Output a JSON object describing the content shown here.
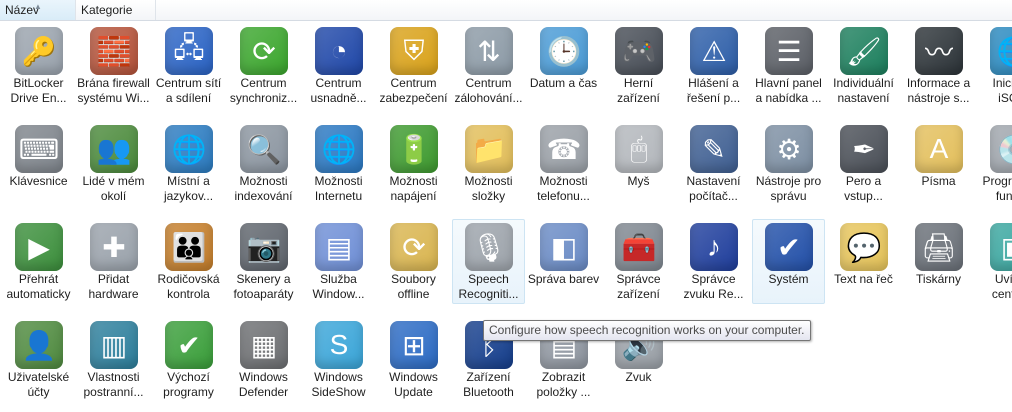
{
  "columns": [
    {
      "label": "Název",
      "sorted": true
    },
    {
      "label": "Kategorie",
      "sorted": false
    }
  ],
  "rows": [
    [
      {
        "label": "BitLocker Drive En...",
        "icon": "bitlocker-drive-icon",
        "color": "#9aa3ad",
        "glyph": "🔑"
      },
      {
        "label": "Brána firewall systému Wi...",
        "icon": "firewall-brick-icon",
        "color": "#b5533a",
        "glyph": "🧱"
      },
      {
        "label": "Centrum sítí a sdílení",
        "icon": "network-center-icon",
        "color": "#2a63c4",
        "glyph": "🖧"
      },
      {
        "label": "Centrum synchroniz...",
        "icon": "sync-center-icon",
        "color": "#3ba62d",
        "glyph": "⟳"
      },
      {
        "label": "Centrum usnadně...",
        "icon": "ease-of-access-icon",
        "color": "#1f47a8",
        "glyph": "◔"
      },
      {
        "label": "Centrum zabezpečení",
        "icon": "security-shield-icon",
        "color": "#d9a21a",
        "glyph": "⛨"
      },
      {
        "label": "Centrum zálohování...",
        "icon": "backup-center-icon",
        "color": "#8c9aa6",
        "glyph": "⇅"
      },
      {
        "label": "Datum a čas",
        "icon": "date-time-icon",
        "color": "#4a9bd6",
        "glyph": "🕒"
      },
      {
        "label": "Herní zařízení",
        "icon": "gamepad-icon",
        "color": "#474d56",
        "glyph": "🎮"
      },
      {
        "label": "Hlášení a řešení p...",
        "icon": "problem-reports-icon",
        "color": "#2d5ea8",
        "glyph": "⚠"
      },
      {
        "label": "Hlavní panel a nabídka ...",
        "icon": "taskbar-start-menu-icon",
        "color": "#5b5f66",
        "glyph": "☰"
      },
      {
        "label": "Individuální nastavení",
        "icon": "personalization-icon",
        "color": "#1c7f5d",
        "glyph": "🖌"
      },
      {
        "label": "Informace a nástroje s...",
        "icon": "performance-info-icon",
        "color": "#2c3338",
        "glyph": "〰"
      },
      {
        "label": "Iniciátor iSCSI",
        "icon": "iscsi-globe-icon",
        "color": "#2a8ac0",
        "glyph": "🌐"
      }
    ],
    [
      {
        "label": "Klávesnice",
        "icon": "keyboard-icon",
        "color": "#7f858c",
        "glyph": "⌨"
      },
      {
        "label": "Lidé v mém okolí",
        "icon": "people-near-me-icon",
        "color": "#4b8a3b",
        "glyph": "👥"
      },
      {
        "label": "Místní a jazykov...",
        "icon": "regional-clock-globe-icon",
        "color": "#2b7bc0",
        "glyph": "🌐"
      },
      {
        "label": "Možnosti indexování",
        "icon": "indexing-icon",
        "color": "#8b95a0",
        "glyph": "🔍"
      },
      {
        "label": "Možnosti Internetu",
        "icon": "internet-options-icon",
        "color": "#2a78c2",
        "glyph": "🌐"
      },
      {
        "label": "Možnosti napájení",
        "icon": "power-options-icon",
        "color": "#3e9a2f",
        "glyph": "🔋"
      },
      {
        "label": "Možnosti složky",
        "icon": "folder-options-icon",
        "color": "#e2be5a",
        "glyph": "📁"
      },
      {
        "label": "Možnosti telefonu...",
        "icon": "phone-modem-icon",
        "color": "#9aa0a7",
        "glyph": "☎"
      },
      {
        "label": "Myš",
        "icon": "mouse-icon",
        "color": "#b3b7bc",
        "glyph": "🖱"
      },
      {
        "label": "Nastavení počítač...",
        "icon": "tablet-pc-icon",
        "color": "#3f5f92",
        "glyph": "✎"
      },
      {
        "label": "Nástroje pro správu",
        "icon": "admin-tools-icon",
        "color": "#7d8fa3",
        "glyph": "⚙"
      },
      {
        "label": "Pero a vstup...",
        "icon": "pen-input-icon",
        "color": "#4a4f57",
        "glyph": "✒"
      },
      {
        "label": "Písma",
        "icon": "fonts-folder-icon",
        "color": "#e3bf5c",
        "glyph": "A"
      },
      {
        "label": "Programy a funkce",
        "icon": "programs-disc-icon",
        "color": "#a0a6ad",
        "glyph": "💿"
      }
    ],
    [
      {
        "label": "Přehrát automaticky",
        "icon": "autoplay-icon",
        "color": "#3c8f3c",
        "glyph": "▶"
      },
      {
        "label": "Přidat hardware",
        "icon": "add-hardware-icon",
        "color": "#9aa2ab",
        "glyph": "✚"
      },
      {
        "label": "Rodičovská kontrola",
        "icon": "parental-controls-icon",
        "color": "#c47e2b",
        "glyph": "👪"
      },
      {
        "label": "Skenery a fotoaparáty",
        "icon": "scanner-camera-icon",
        "color": "#5f656d",
        "glyph": "📷"
      },
      {
        "label": "Služba Window...",
        "icon": "cardspace-icon",
        "color": "#6f8fd6",
        "glyph": "▤"
      },
      {
        "label": "Soubory offline",
        "icon": "offline-files-icon",
        "color": "#d9b550",
        "glyph": "⟳"
      },
      {
        "label": "Speech Recogniti...",
        "icon": "microphone-icon",
        "color": "#9ea4ab",
        "glyph": "🎙",
        "hover": true
      },
      {
        "label": "Správa barev",
        "icon": "color-management-icon",
        "color": "#6a8bc5",
        "glyph": "◧"
      },
      {
        "label": "Správce zařízení",
        "icon": "device-manager-icon",
        "color": "#7f8790",
        "glyph": "🧰"
      },
      {
        "label": "Správce zvuku Re...",
        "icon": "realtek-audio-icon",
        "color": "#1f3e9c",
        "glyph": "♪"
      },
      {
        "label": "Systém",
        "icon": "system-computer-icon",
        "color": "#2350a8",
        "glyph": "✔",
        "hover": true
      },
      {
        "label": "Text na řeč",
        "icon": "text-to-speech-icon",
        "color": "#e6c45a",
        "glyph": "💬"
      },
      {
        "label": "Tiskárny",
        "icon": "printer-icon",
        "color": "#6a7078",
        "glyph": "🖨"
      },
      {
        "label": "Uvítací centrum",
        "icon": "welcome-center-icon",
        "color": "#3aa7a0",
        "glyph": "▣"
      }
    ],
    [
      {
        "label": "Uživatelské účty",
        "icon": "user-accounts-icon",
        "color": "#4f8a3f",
        "glyph": "👤"
      },
      {
        "label": "Vlastnosti postranní...",
        "icon": "sidebar-properties-icon",
        "color": "#2d7f9c",
        "glyph": "▥"
      },
      {
        "label": "Výchozí programy",
        "icon": "default-programs-icon",
        "color": "#3a9e3a",
        "glyph": "✔"
      },
      {
        "label": "Windows Defender",
        "icon": "defender-wall-icon",
        "color": "#6d6f72",
        "glyph": "▦"
      },
      {
        "label": "Windows SideShow",
        "icon": "sideshow-icon",
        "color": "#3aa5d8",
        "glyph": "S"
      },
      {
        "label": "Windows Update",
        "icon": "windows-update-icon",
        "color": "#2c6bc4",
        "glyph": "⊞"
      },
      {
        "label": "Zařízení Bluetooth",
        "icon": "bluetooth-icon",
        "color": "#153e8c",
        "glyph": "ᛒ"
      },
      {
        "label": "Zobrazit položky ...",
        "icon": "show-items-icon",
        "color": "#8f96a0",
        "glyph": "▤"
      },
      {
        "label": "Zvuk",
        "icon": "speaker-icon",
        "color": "#9aa0a7",
        "glyph": "🔊"
      }
    ]
  ],
  "tooltip": "Configure how speech recognition works on your computer."
}
